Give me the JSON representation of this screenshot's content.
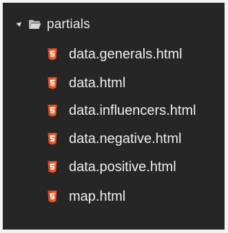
{
  "tree": {
    "folder": {
      "name": "partials",
      "expanded": true,
      "icon": "folder-open-icon"
    },
    "files": [
      {
        "name": "data.generals.html",
        "icon": "html5-icon"
      },
      {
        "name": "data.html",
        "icon": "html5-icon"
      },
      {
        "name": "data.influencers.html",
        "icon": "html5-icon"
      },
      {
        "name": "data.negative.html",
        "icon": "html5-icon"
      },
      {
        "name": "data.positive.html",
        "icon": "html5-icon"
      },
      {
        "name": "map.html",
        "icon": "html5-icon"
      }
    ]
  },
  "colors": {
    "background": "#262626",
    "text": "#eeeeee",
    "html_icon": "#e44d26",
    "folder_icon": "#c2c2c2"
  }
}
